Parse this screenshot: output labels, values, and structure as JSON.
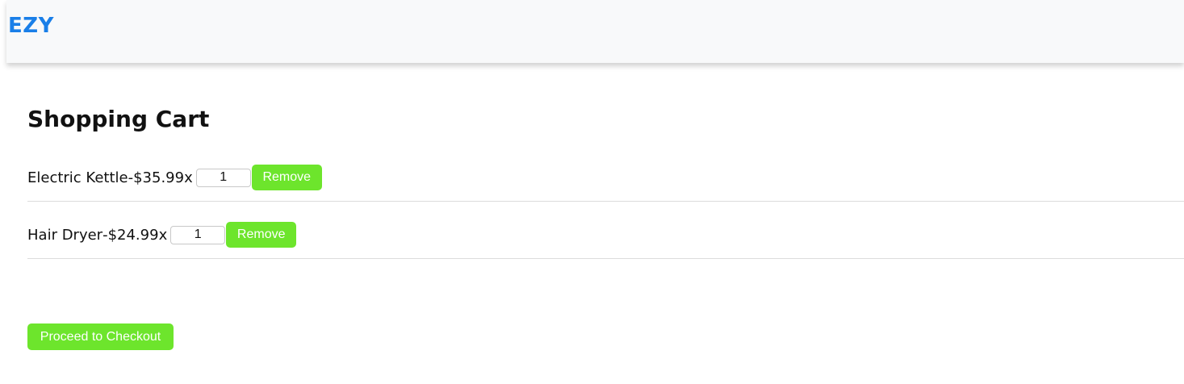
{
  "navbar": {
    "brand": "EZY"
  },
  "page": {
    "title": "Shopping Cart"
  },
  "cart": {
    "items": [
      {
        "name": "Electric Kettle",
        "separator": " - ",
        "price": "$35.99",
        "times": " x",
        "quantity": "1",
        "remove_label": "Remove"
      },
      {
        "name": "Hair Dryer",
        "separator": " - ",
        "price": "$24.99",
        "times": " x",
        "quantity": "1",
        "remove_label": "Remove"
      }
    ]
  },
  "checkout": {
    "label": "Proceed to Checkout"
  },
  "colors": {
    "brand": "#1a7fe8",
    "button": "#6de52c",
    "navbar_bg": "#f8f9fa"
  }
}
